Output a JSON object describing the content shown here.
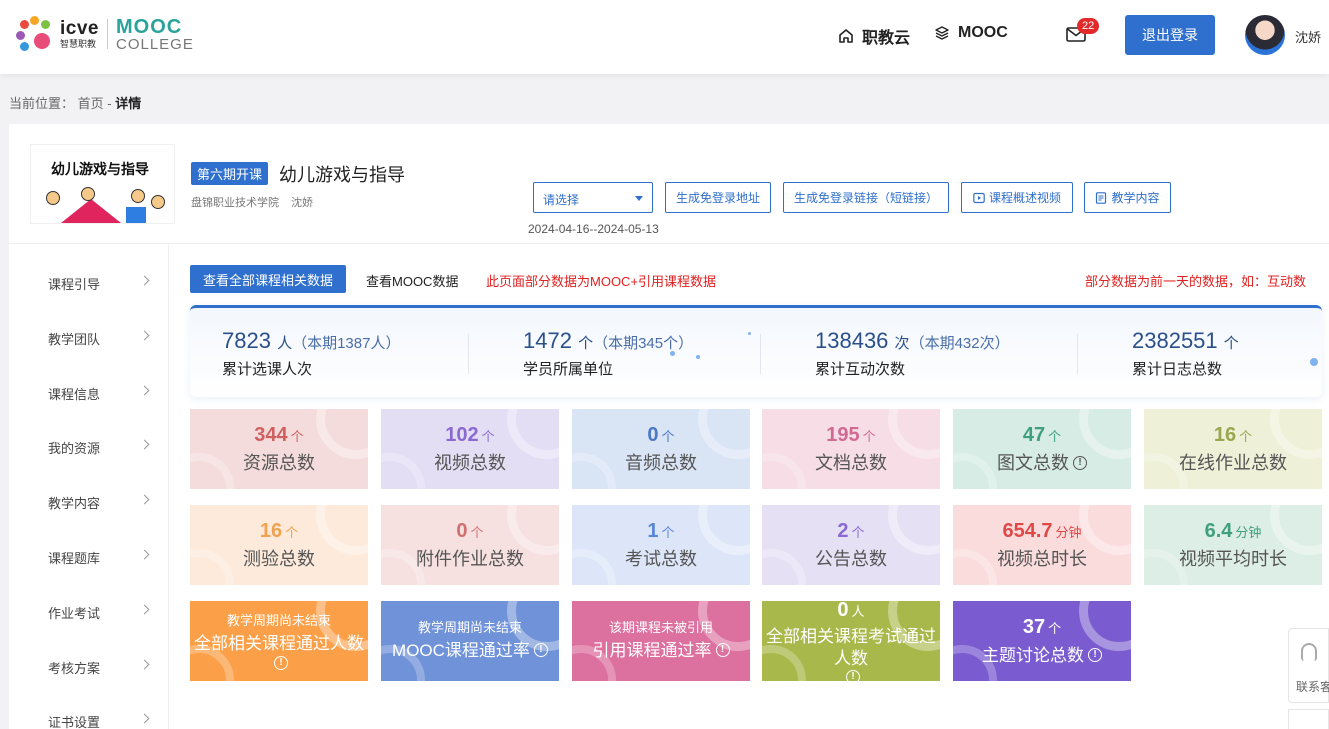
{
  "header": {
    "logo_icve": "icve",
    "logo_icve_sub": "智慧职教",
    "logo_mooc": "MOOC",
    "logo_college": "COLLEGE",
    "nav_zhijiaoyun": "职教云",
    "nav_mooc": "MOOC",
    "mail_count": "22",
    "logout_label": "退出登录",
    "username": "沈娇"
  },
  "breadcrumb": {
    "prefix": "当前位置：",
    "home": "首页",
    "sep": " - ",
    "current": "详情"
  },
  "course": {
    "cover_title": "幼儿游戏与指导",
    "term_tag": "第六期开课",
    "title": "幼儿游戏与指导",
    "org": "盘锦职业技术学院",
    "teacher": "沈娇",
    "select_placeholder": "请选择",
    "btn_login_free_url": "生成免登录地址",
    "btn_login_free_short": "生成免登录链接（短链接）",
    "btn_overview_video": "课程概述视频",
    "btn_teaching_content": "教学内容",
    "date_range": "2024-04-16--2024-05-13"
  },
  "sidenav": {
    "items": [
      "课程引导",
      "教学团队",
      "课程信息",
      "我的资源",
      "教学内容",
      "课程题库",
      "作业考试",
      "考核方案",
      "证书设置"
    ]
  },
  "tabs": {
    "active": "查看全部课程相关数据",
    "mooc": "查看MOOC数据",
    "note_left": "此页面部分数据为MOOC+引用课程数据",
    "note_right": "部分数据为前一天的数据，如：互动数"
  },
  "summary": [
    {
      "value": "7823",
      "unit": "人",
      "extra": "（本期1387人）",
      "label": "累计选课人次"
    },
    {
      "value": "1472",
      "unit": "个",
      "extra": "（本期345个）",
      "label": "学员所属单位"
    },
    {
      "value": "138436",
      "unit": "次",
      "extra": "（本期432次）",
      "label": "累计互动次数"
    },
    {
      "value": "2382551",
      "unit": "个",
      "extra": "",
      "label": "累计日志总数"
    }
  ],
  "tiles_row1": [
    {
      "value": "344",
      "unit": "个",
      "label": "资源总数"
    },
    {
      "value": "102",
      "unit": "个",
      "label": "视频总数"
    },
    {
      "value": "0",
      "unit": "个",
      "label": "音频总数"
    },
    {
      "value": "195",
      "unit": "个",
      "label": "文档总数"
    },
    {
      "value": "47",
      "unit": "个",
      "label": "图文总数"
    },
    {
      "value": "16",
      "unit": "个",
      "label": "在线作业总数"
    }
  ],
  "tiles_row2": [
    {
      "value": "16",
      "unit": "个",
      "label": "测验总数"
    },
    {
      "value": "0",
      "unit": "个",
      "label": "附件作业总数"
    },
    {
      "value": "1",
      "unit": "个",
      "label": "考试总数"
    },
    {
      "value": "2",
      "unit": "个",
      "label": "公告总数"
    },
    {
      "value": "654.7",
      "unit": "分钟",
      "label": "视频总时长"
    },
    {
      "value": "6.4",
      "unit": "分钟",
      "label": "视频平均时长"
    }
  ],
  "tiles_row3": [
    {
      "sub": "教学周期尚未结束",
      "label": "全部相关课程通过人数"
    },
    {
      "sub": "教学周期尚未结束",
      "label": "MOOC课程通过率"
    },
    {
      "sub": "该期课程未被引用",
      "label": "引用课程通过率"
    },
    {
      "value": "0",
      "unit": "人",
      "label": "全部相关课程考试通过人数"
    },
    {
      "value": "37",
      "unit": "个",
      "label": "主题讨论总数"
    }
  ],
  "side_widget": {
    "label": "联系客服"
  },
  "colors": {
    "primary": "#2f6fcd",
    "danger": "#e02020",
    "orange_tile": "#fba049",
    "blue_tile": "#6f92d8",
    "pink_tile": "#dc709f",
    "olive_tile": "#a9b84a",
    "purple_tile": "#7a5cd0"
  }
}
